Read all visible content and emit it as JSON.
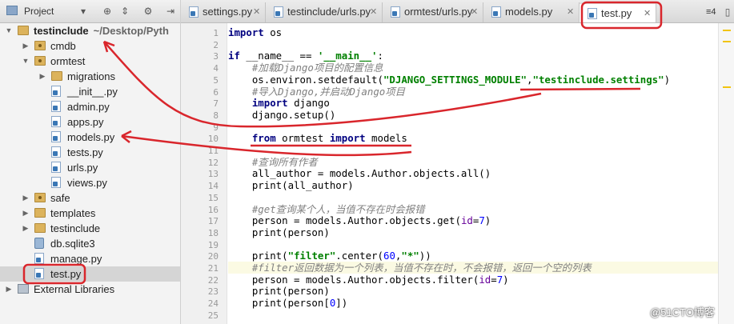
{
  "project_panel": {
    "toolbar": {
      "title": "Project",
      "dropdown_icon": "chevron-down-icon",
      "icons": [
        "target-icon",
        "collapse-icon",
        "gear-icon",
        "hide-panel-icon"
      ]
    },
    "tree": [
      {
        "label": "testinclude",
        "path": "~/Desktop/Pyth",
        "type": "folder",
        "expanded": true,
        "bold": true
      },
      {
        "label": "cmdb",
        "type": "package",
        "expanded": false
      },
      {
        "label": "ormtest",
        "type": "package",
        "expanded": true
      },
      {
        "label": "migrations",
        "type": "folder",
        "expanded": false
      },
      {
        "label": "__init__.py",
        "type": "py"
      },
      {
        "label": "admin.py",
        "type": "py"
      },
      {
        "label": "apps.py",
        "type": "py"
      },
      {
        "label": "models.py",
        "type": "py"
      },
      {
        "label": "tests.py",
        "type": "py"
      },
      {
        "label": "urls.py",
        "type": "py"
      },
      {
        "label": "views.py",
        "type": "py"
      },
      {
        "label": "safe",
        "type": "package",
        "expanded": false
      },
      {
        "label": "templates",
        "type": "folder",
        "expanded": false
      },
      {
        "label": "testinclude",
        "type": "folder",
        "expanded": false
      },
      {
        "label": "db.sqlite3",
        "type": "db"
      },
      {
        "label": "manage.py",
        "type": "py"
      },
      {
        "label": "test.py",
        "type": "py",
        "selected": true
      },
      {
        "label": "External Libraries",
        "type": "lib",
        "expanded": false
      }
    ]
  },
  "tabs": [
    {
      "label": "settings.py"
    },
    {
      "label": "testinclude/urls.py"
    },
    {
      "label": "ormtest/urls.py"
    },
    {
      "label": "models.py"
    },
    {
      "label": "test.py",
      "active": true
    }
  ],
  "tabs_overflow": "≡4",
  "editor": {
    "lines": [
      {
        "n": "1",
        "text": "import os"
      },
      {
        "n": "2",
        "text": ""
      },
      {
        "n": "3",
        "text": "if __name__ == '__main__':"
      },
      {
        "n": "4",
        "text": "    #加载Django项目的配置信息"
      },
      {
        "n": "5",
        "text": "    os.environ.setdefault(\"DJANGO_SETTINGS_MODULE\",\"testinclude.settings\")"
      },
      {
        "n": "6",
        "text": "    #导入Django,并启动Django项目"
      },
      {
        "n": "7",
        "text": "    import django"
      },
      {
        "n": "8",
        "text": "    django.setup()"
      },
      {
        "n": "9",
        "text": ""
      },
      {
        "n": "10",
        "text": "    from ormtest import models"
      },
      {
        "n": "11",
        "text": ""
      },
      {
        "n": "12",
        "text": "    #查询所有作者"
      },
      {
        "n": "13",
        "text": "    all_author = models.Author.objects.all()"
      },
      {
        "n": "14",
        "text": "    print(all_author)"
      },
      {
        "n": "15",
        "text": ""
      },
      {
        "n": "16",
        "text": "    #get查询某个人，当值不存在时会报错"
      },
      {
        "n": "17",
        "text": "    person = models.Author.objects.get(id=7)"
      },
      {
        "n": "18",
        "text": "    print(person)"
      },
      {
        "n": "19",
        "text": ""
      },
      {
        "n": "20",
        "text": "    print(\"filter\".center(60,\"*\"))"
      },
      {
        "n": "21",
        "text": "    #filter返回数据为一个列表，当值不存在时，不会报错，返回一个空的列表"
      },
      {
        "n": "22",
        "text": "    person = models.Author.objects.filter(id=7)"
      },
      {
        "n": "23",
        "text": "    print(person)"
      },
      {
        "n": "24",
        "text": "    print(person[0])"
      },
      {
        "n": "25",
        "text": ""
      }
    ],
    "highlighted_line": "21"
  },
  "watermark": "@51CTO博客",
  "annotation_color": "#d9262c"
}
